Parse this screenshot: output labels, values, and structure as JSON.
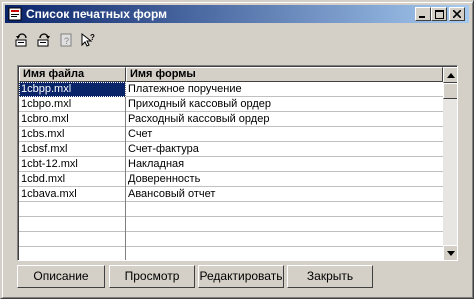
{
  "window": {
    "title": "Список печатных форм",
    "minimize_icon": "minimize-icon",
    "maximize_icon": "maximize-icon",
    "close_icon": "close-icon"
  },
  "toolbar": {
    "tools": [
      {
        "name": "refresh-print-icon"
      },
      {
        "name": "refresh-print-alt-icon"
      },
      {
        "name": "help-book-icon"
      },
      {
        "name": "context-help-icon"
      }
    ]
  },
  "table": {
    "headers": [
      "Имя файла",
      "Имя формы"
    ],
    "rows": [
      {
        "file": "1cbpp.mxl",
        "form": "Платежное поручение"
      },
      {
        "file": "1cbpo.mxl",
        "form": "Приходный кассовый ордер"
      },
      {
        "file": "1cbro.mxl",
        "form": "Расходный кассовый ордер"
      },
      {
        "file": "1cbs.mxl",
        "form": "Счет"
      },
      {
        "file": "1cbsf.mxl",
        "form": "Счет-фактура"
      },
      {
        "file": "1cbt-12.mxl",
        "form": "Накладная"
      },
      {
        "file": "1cbd.mxl",
        "form": "Доверенность"
      },
      {
        "file": "1cbava.mxl",
        "form": "Авансовый отчет"
      },
      {
        "file": "",
        "form": ""
      },
      {
        "file": "",
        "form": ""
      },
      {
        "file": "",
        "form": ""
      },
      {
        "file": "",
        "form": ""
      }
    ],
    "selected_row": 0
  },
  "buttons": {
    "description": "Описание",
    "view": "Просмотр",
    "edit": "Редактировать",
    "close": "Закрыть"
  },
  "colors": {
    "title_start": "#0a246a",
    "title_end": "#a6caf0",
    "face": "#d4d0c8",
    "selection": "#0a246a"
  }
}
